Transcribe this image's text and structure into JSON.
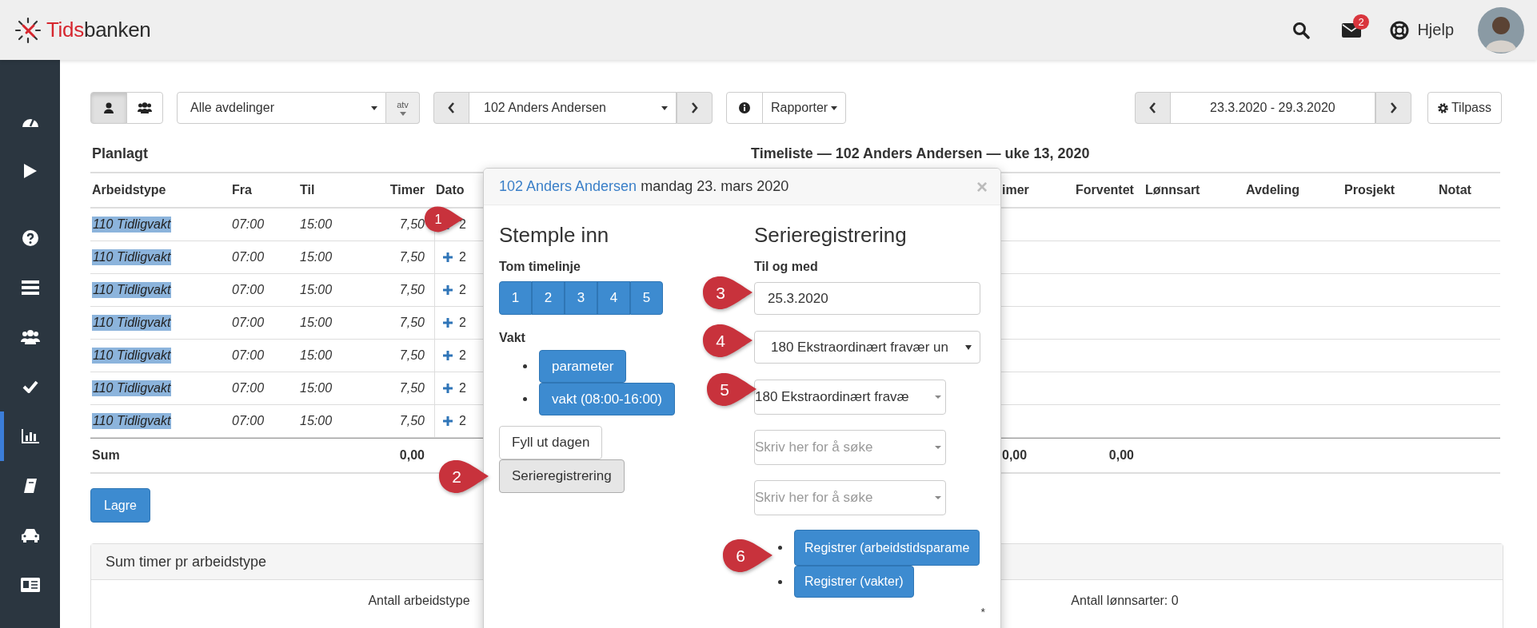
{
  "header": {
    "logo_prefix": "Tids",
    "logo_suffix": "banken",
    "messages_badge": "2",
    "help": "Hjelp"
  },
  "sidebar": {
    "items": [
      {
        "selected": false
      },
      {
        "selected": false
      },
      {
        "selected": false
      },
      {
        "selected": false
      },
      {
        "selected": false
      },
      {
        "selected": false
      },
      {
        "selected": true
      },
      {
        "selected": false
      },
      {
        "selected": false
      },
      {
        "selected": false
      }
    ]
  },
  "toolbar": {
    "view_buttons": [
      {
        "selected": true
      },
      {
        "selected": false
      }
    ],
    "department": "Alle avdelinger",
    "atv": "atv",
    "employee": "102 Anders Andersen",
    "reports": "Rapporter",
    "period": "23.3.2020 - 29.3.2020",
    "customize": "Tilpass"
  },
  "planned": {
    "title": "Planlagt",
    "columns": [
      "Arbeidstype",
      "Fra",
      "Til",
      "Timer",
      "Dato"
    ],
    "rows": [
      {
        "type": "110 Tidligvakt",
        "from": "07:00",
        "to": "15:00",
        "hours": "7,50",
        "date": "2"
      },
      {
        "type": "110 Tidligvakt",
        "from": "07:00",
        "to": "15:00",
        "hours": "7,50",
        "date": "2"
      },
      {
        "type": "110 Tidligvakt",
        "from": "07:00",
        "to": "15:00",
        "hours": "7,50",
        "date": "2"
      },
      {
        "type": "110 Tidligvakt",
        "from": "07:00",
        "to": "15:00",
        "hours": "7,50",
        "date": "2"
      },
      {
        "type": "110 Tidligvakt",
        "from": "07:00",
        "to": "15:00",
        "hours": "7,50",
        "date": "2"
      },
      {
        "type": "110 Tidligvakt",
        "from": "07:00",
        "to": "15:00",
        "hours": "7,50",
        "date": "2"
      },
      {
        "type": "110 Tidligvakt",
        "from": "07:00",
        "to": "15:00",
        "hours": "7,50",
        "date": "2"
      }
    ],
    "sum_label": "Sum",
    "sum_hours": "0,00"
  },
  "timesheet": {
    "title": "Timeliste — 102 Anders Andersen — uke 13, 2020",
    "columns": [
      "imer",
      "Forventet",
      "Lønnsart",
      "Avdeling",
      "Prosjekt",
      "Notat"
    ],
    "sum_hours": "0,00",
    "sum_expected": "0,00"
  },
  "save": "Lagre",
  "summary": {
    "title": "Sum timer pr arbeidstype",
    "left": "Antall arbeidstype",
    "right": "Antall lønnsarter: 0"
  },
  "popup": {
    "employee": "102 Anders Andersen",
    "date": "mandag 23. mars 2020",
    "close": "×",
    "left": {
      "title": "Stemple inn",
      "timeline_label": "Tom timelinje",
      "timeline_buttons": [
        "1",
        "2",
        "3",
        "4",
        "5"
      ],
      "shift_label": "Vakt",
      "shift_buttons": [
        "parameter",
        "vakt (08:00-16:00)"
      ],
      "fill_day": "Fyll ut dagen",
      "series_button": {
        "label": "Serieregistrering",
        "selected": true
      }
    },
    "right": {
      "title": "Serieregistrering",
      "until_label": "Til og med",
      "until_value": "25.3.2020",
      "selects": [
        {
          "kind": "native",
          "value": "180 Ekstraordinært fravær un"
        },
        {
          "kind": "search",
          "value": "180 Ekstraordinært fravæ"
        },
        {
          "kind": "search",
          "placeholder": "Skriv her for å søke"
        },
        {
          "kind": "search",
          "placeholder": "Skriv her for å søke"
        }
      ],
      "register_buttons": [
        "Registrer (arbeidstidsparame",
        "Registrer (vakter)"
      ],
      "footnote": "*"
    }
  },
  "callouts": [
    "1",
    "2",
    "3",
    "4",
    "5",
    "6"
  ]
}
